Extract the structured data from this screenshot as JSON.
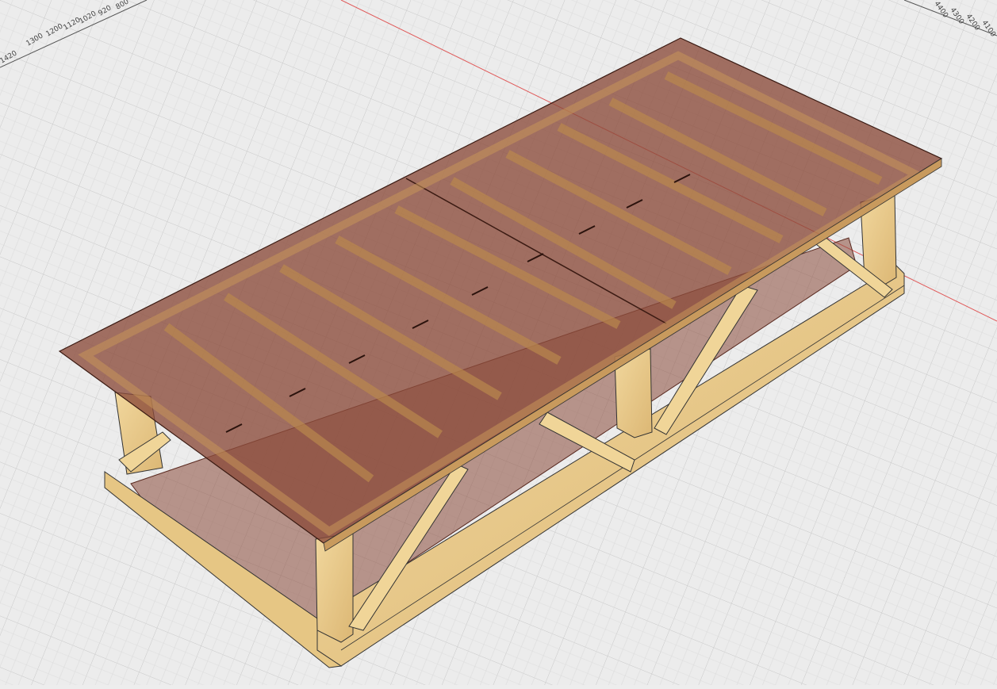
{
  "viewport": {
    "background": "#ececec",
    "grid_color": "#c9c9c9",
    "axis_x_color": "#e05a5a"
  },
  "ruler_left": {
    "ticks": [
      "1420",
      "1300",
      "1200",
      "1120",
      "1020",
      "920",
      "800"
    ]
  },
  "ruler_right": {
    "ticks": [
      "4400",
      "4300",
      "4200",
      "4100"
    ]
  },
  "model": {
    "wood_color": "#e8c98a",
    "glass_color": "#8a4a3a"
  }
}
